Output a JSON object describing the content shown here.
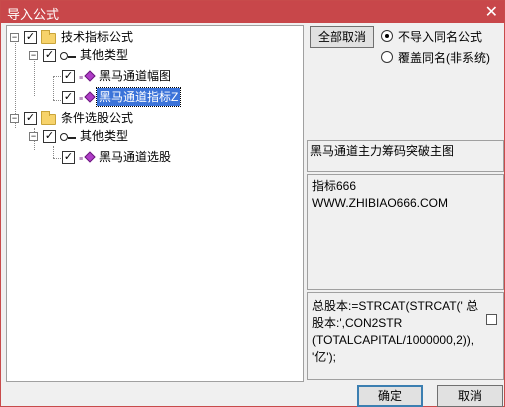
{
  "window": {
    "title": "导入公式",
    "close_glyph": "✕"
  },
  "tree": [
    {
      "id": "n1",
      "label": "技术指标公式",
      "icon": "folder-icon",
      "checked": true,
      "toggle": "−"
    },
    {
      "id": "n2",
      "label": "其他类型",
      "icon": "key-icon",
      "checked": true,
      "toggle": "−"
    },
    {
      "id": "n3",
      "label": "黑马通道幅图",
      "icon": "formula-icon",
      "checked": true
    },
    {
      "id": "n4",
      "label": "黑马通道指标Z",
      "icon": "formula-icon",
      "checked": true,
      "selected": true
    },
    {
      "id": "n5",
      "label": "条件选股公式",
      "icon": "folder-icon",
      "checked": true,
      "toggle": "−"
    },
    {
      "id": "n6",
      "label": "其他类型",
      "icon": "key-icon",
      "checked": true,
      "toggle": "−"
    },
    {
      "id": "n7",
      "label": "黑马通道选股",
      "icon": "formula-icon",
      "checked": true
    }
  ],
  "right": {
    "deselect_all": "全部取消",
    "radio_options": [
      {
        "label": "不导入同名公式",
        "selected": true
      },
      {
        "label": "覆盖同名(非系统)",
        "selected": false
      }
    ],
    "formula_name": "黑马通道主力筹码突破主图",
    "description_lines": [
      "指标666",
      "WWW.ZHIBIAO666.COM"
    ],
    "code_lines": [
      "总股本:=STRCAT(STRCAT(' 总",
      "股本:',CON2STR",
      "(TOTALCAPITAL/1000000,2)),",
      "'亿');"
    ]
  },
  "buttons": {
    "ok": "确定",
    "cancel": "取消"
  },
  "colors": {
    "titlebar": "#c8474a",
    "selection": "#3b73d9"
  }
}
